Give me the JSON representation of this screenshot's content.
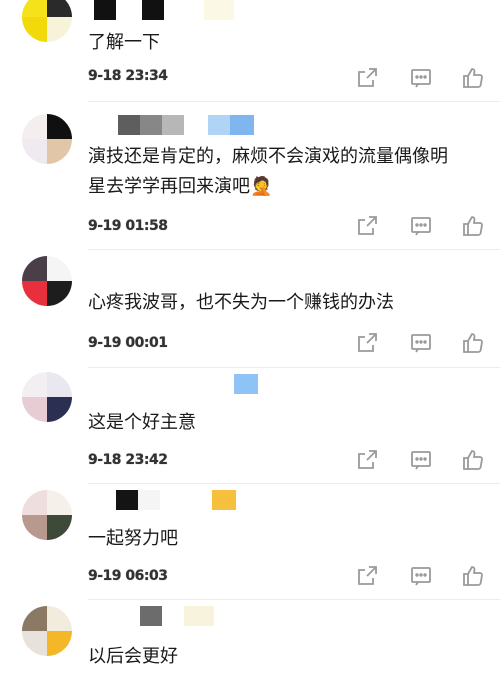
{
  "colors": {
    "icon": "#9a9a9a",
    "divider": "#ececec",
    "time": "#333333"
  },
  "icons": {
    "share": "share-icon",
    "reply": "reply-icon",
    "like": "like-icon"
  },
  "comments": [
    {
      "text": "了解一下",
      "time": "9-18 23:34"
    },
    {
      "text": "演技还是肯定的，麻烦不会演戏的流量偶像明星去学学再回来演吧🤦",
      "time": "9-19 01:58"
    },
    {
      "text": "心疼我波哥，也不失为一个赚钱的办法",
      "time": "9-19 00:01"
    },
    {
      "text": "这是个好主意",
      "time": "9-18 23:42"
    },
    {
      "text": "一起努力吧",
      "time": "9-19 06:03"
    },
    {
      "text": "以后会更好",
      "time": ""
    }
  ]
}
